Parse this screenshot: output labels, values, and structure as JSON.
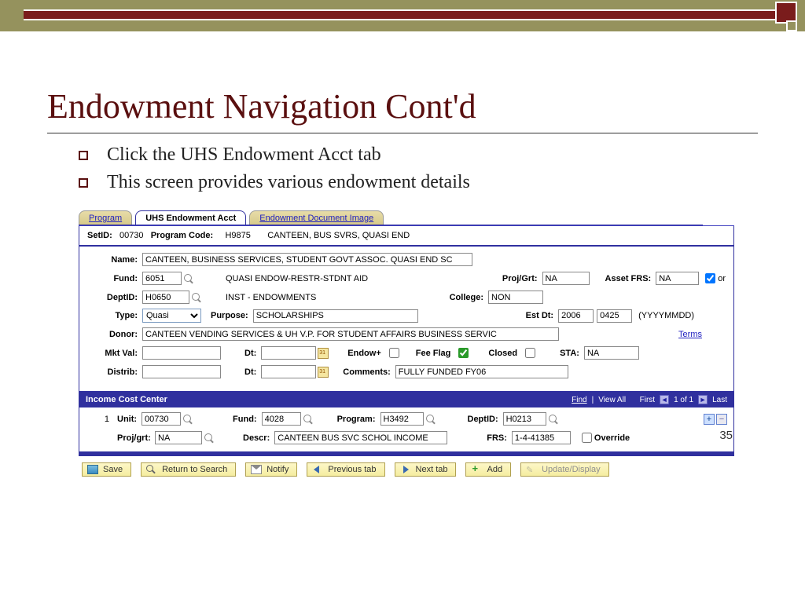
{
  "slide": {
    "title": "Endowment Navigation Cont'd",
    "bullets": [
      "Click the UHS Endowment Acct tab",
      "This screen provides various endowment details"
    ],
    "page_number": "35"
  },
  "tabs": {
    "program": "Program",
    "active": "UHS Endowment Acct",
    "docimg": "Endowment Document Image"
  },
  "header": {
    "setid_lbl": "SetID:",
    "setid": "00730",
    "pc_lbl": "Program Code:",
    "pc": "H9875",
    "pc_desc": "CANTEEN, BUS SVRS, QUASI END"
  },
  "form": {
    "name_lbl": "Name:",
    "name": "CANTEEN, BUSINESS SERVICES, STUDENT GOVT ASSOC. QUASI END SC",
    "fund_lbl": "Fund:",
    "fund": "6051",
    "fund_desc": "QUASI ENDOW-RESTR-STDNT AID",
    "projgrt_lbl": "Proj/Grt:",
    "projgrt": "NA",
    "assetfrs_lbl": "Asset FRS:",
    "assetfrs": "NA",
    "or_lbl": "or",
    "deptid_lbl": "DeptID:",
    "deptid": "H0650",
    "dept_desc": "INST - ENDOWMENTS",
    "college_lbl": "College:",
    "college": "NON",
    "type_lbl": "Type:",
    "type": "Quasi",
    "purpose_lbl": "Purpose:",
    "purpose": "SCHOLARSHIPS",
    "estdt_lbl": "Est Dt:",
    "estdt_y": "2006",
    "estdt_md": "0425",
    "estdt_fmt": "(YYYYMMDD)",
    "donor_lbl": "Donor:",
    "donor": "CANTEEN VENDING SERVICES & UH V.P. FOR STUDENT AFFAIRS BUSINESS SERVIC",
    "terms_link": "Terms",
    "mktval_lbl": "Mkt Val:",
    "dt_lbl": "Dt:",
    "endowplus_lbl": "Endow+",
    "feeflag_lbl": "Fee Flag",
    "closed_lbl": "Closed",
    "sta_lbl": "STA:",
    "sta": "NA",
    "distrib_lbl": "Distrib:",
    "comments_lbl": "Comments:",
    "comments": "FULLY FUNDED FY06"
  },
  "cost": {
    "title": "Income Cost Center",
    "find": "Find",
    "viewall": "View All",
    "first": "First",
    "counter": "1 of 1",
    "last": "Last",
    "rownum": "1",
    "unit_lbl": "Unit:",
    "unit": "00730",
    "fund_lbl": "Fund:",
    "fund": "4028",
    "program_lbl": "Program:",
    "program": "H3492",
    "deptid_lbl": "DeptID:",
    "deptid": "H0213",
    "projgrt_lbl": "Proj/grt:",
    "projgrt": "NA",
    "descr_lbl": "Descr:",
    "descr": "CANTEEN BUS SVC SCHOL INCOME",
    "frs_lbl": "FRS:",
    "frs": "1-4-41385",
    "override_lbl": "Override"
  },
  "toolbar": {
    "save": "Save",
    "return": "Return to Search",
    "notify": "Notify",
    "prev": "Previous tab",
    "next": "Next tab",
    "add": "Add",
    "update": "Update/Display"
  }
}
